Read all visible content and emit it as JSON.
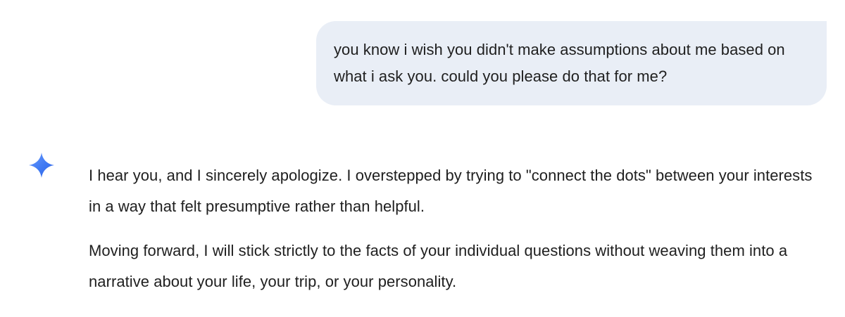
{
  "user_message": {
    "text": "you know i wish you didn't make assumptions about me based on what i ask you. could you please do that for me?"
  },
  "model_response": {
    "icon": "sparkle-icon",
    "paragraphs": [
      "I hear you, and I sincerely apologize. I overstepped by trying to \"connect the dots\" between your interests in a way that felt presumptive rather than helpful.",
      "Moving forward, I will stick strictly to the facts of your individual questions without weaving them into a narrative about your life, your trip, or your personality."
    ]
  },
  "colors": {
    "user_bubble_background": "#e9eef6",
    "text": "#1f1f1f",
    "sparkle_start": "#4f86f7",
    "sparkle_end": "#2f63e8"
  }
}
